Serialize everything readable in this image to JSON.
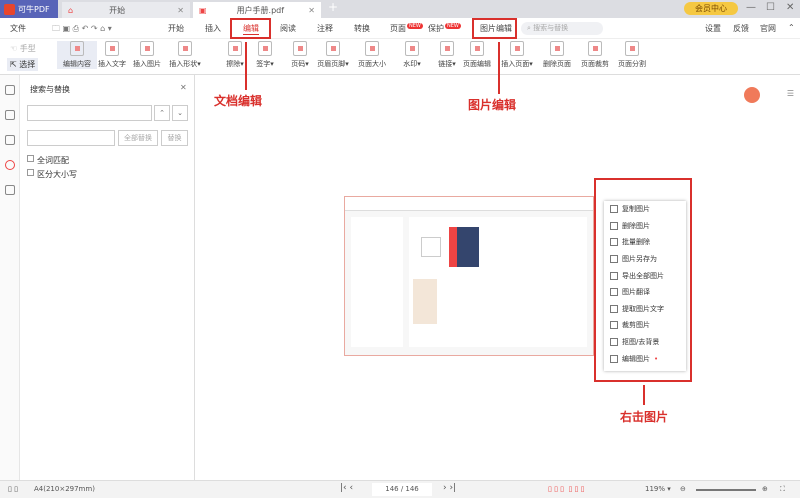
{
  "app": {
    "name": "可牛PDF",
    "vip": "会员中心"
  },
  "tabs": [
    {
      "label": "开始"
    },
    {
      "label": "用户手册.pdf"
    }
  ],
  "menu": {
    "file": "文件",
    "items": [
      "开始",
      "插入",
      "编辑",
      "阅读",
      "注释",
      "转换",
      "页面",
      "保护",
      "图片编辑"
    ],
    "new_badge": "NEW",
    "search_placeholder": "搜索与替换",
    "right": [
      "设置",
      "反馈",
      "官网"
    ]
  },
  "ribbon": {
    "hand": "手型",
    "select": "选择",
    "buttons": [
      "编辑内容",
      "插入文字",
      "插入图片",
      "插入形状▾",
      "擦除▾",
      "签字▾",
      "页码▾",
      "页眉页脚▾",
      "页面大小",
      "水印▾",
      "链接▾",
      "页面编辑",
      "插入页面▾",
      "删除页面",
      "页面裁剪",
      "页面分割"
    ]
  },
  "panel": {
    "title": "搜索与替换",
    "replace_all": "全部替换",
    "replace": "替换",
    "options": [
      "全词匹配",
      "区分大小写"
    ]
  },
  "context_menu": [
    "复制图片",
    "删除图片",
    "批量删除",
    "图片另存为",
    "导出全部图片",
    "图片翻译",
    "提取图片文字",
    "裁剪图片",
    "抠图/去背景",
    "编辑图片"
  ],
  "annotations": {
    "doc_edit": "文档编辑",
    "image_edit": "图片编辑",
    "right_click": "右击图片"
  },
  "status": {
    "page_size": "A4(210×297mm)",
    "page": "146 / 146",
    "zoom": "119%"
  },
  "colors": {
    "accent": "#d9302c",
    "brand": "#5864b8"
  }
}
